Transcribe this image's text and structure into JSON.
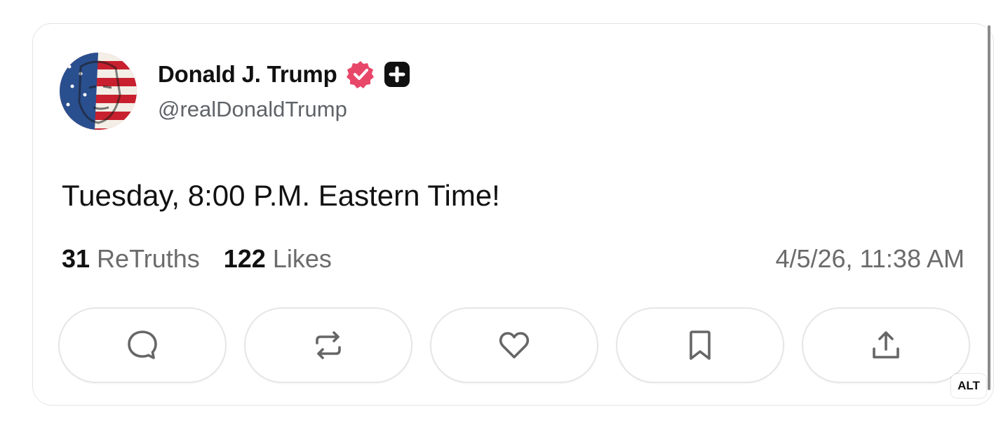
{
  "post": {
    "author": {
      "display_name": "Donald J. Trump",
      "handle": "@realDonaldTrump",
      "verified_icon": "verified-check-icon",
      "plus_icon": "plus-badge-icon"
    },
    "text": "Tuesday, 8:00 P.M. Eastern Time!",
    "stats": {
      "retruths_count": "31",
      "retruths_label": "ReTruths",
      "likes_count": "122",
      "likes_label": "Likes"
    },
    "timestamp": "4/5/26, 11:38 AM"
  },
  "actions": [
    {
      "name": "reply",
      "icon": "reply-bubble-icon"
    },
    {
      "name": "retruth",
      "icon": "retruth-arrows-icon"
    },
    {
      "name": "like",
      "icon": "heart-icon"
    },
    {
      "name": "bookmark",
      "icon": "bookmark-icon"
    },
    {
      "name": "share",
      "icon": "share-upload-icon"
    }
  ],
  "alt_badge": "ALT",
  "colors": {
    "verified": "#e8476a",
    "plus_badge": "#111111",
    "muted_text": "#6b6b6b",
    "border": "#e4e4e4"
  }
}
